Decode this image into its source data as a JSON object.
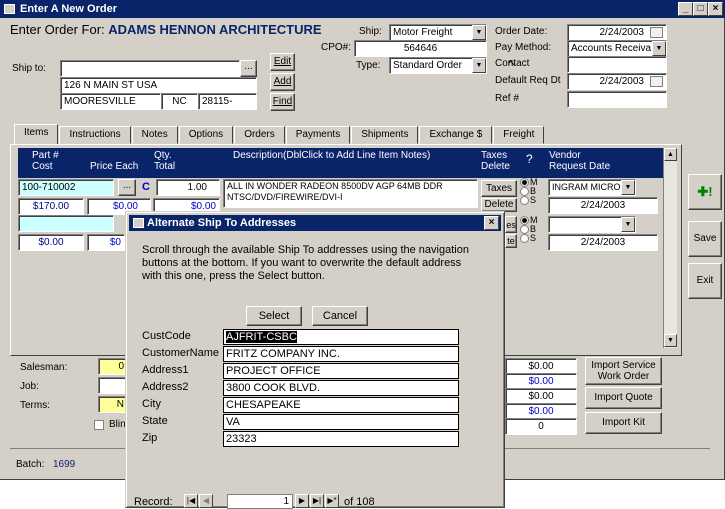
{
  "window": {
    "title": "Enter A New Order",
    "controls": [
      "_",
      "□",
      "×"
    ]
  },
  "header": {
    "enter_order_for_label": "Enter Order For:",
    "customer_name": "ADAMS HENNON ARCHITECTURE",
    "ship_label": "Ship:",
    "ship_value": "Motor Freight",
    "cpo_label": "CPO#:",
    "cpo_value": "564646",
    "type_label": "Type:",
    "type_value": "Standard Order",
    "order_date_label": "Order Date:",
    "order_date_value": "2/24/2003",
    "pay_method_label": "Pay Method:",
    "pay_method_value": "Accounts Receiva",
    "contact_label": "Contact",
    "contact_value": "",
    "default_req_dt_label": "Default Req Dt",
    "default_req_dt_value": "2/24/2003",
    "ref_label": "Ref #",
    "ref_value": "",
    "ship_to_label": "Ship to:",
    "ship_to_line1": "",
    "ship_to_line2": "126 N MAIN ST   USA",
    "ship_to_city": "MOORESVILLE",
    "ship_to_state": "NC",
    "ship_to_zip": "28115-",
    "ellipsis_label": "...",
    "edit_label": "Edit",
    "add_label": "Add",
    "find_label": "Find"
  },
  "tabs": [
    "Items",
    "Instructions",
    "Notes",
    "Options",
    "Orders",
    "Payments",
    "Shipments",
    "Exchange $",
    "Freight"
  ],
  "grid": {
    "headers": {
      "part": "Part #",
      "cost": "Cost",
      "price_each": "Price Each",
      "qty": "Qty.",
      "total": "Total",
      "description": "Description(DblClick to Add Line Item Notes)",
      "taxes": "Taxes",
      "delete": "Delete",
      "question": "?",
      "vendor": "Vendor",
      "request_date": "Request Date"
    },
    "row1": {
      "part": "100-710002",
      "c": "C",
      "qty": "1.00",
      "description": "ALL IN WONDER RADEON 8500DV AGP 64MB DDR NTSC/DVD/FIREWIRE/DVI-I",
      "cost": "$170.00",
      "price": "$0.00",
      "total": "$0.00",
      "taxes_btn": "Taxes",
      "delete_btn": "Delete",
      "vendor": "INGRAM MICRO",
      "request_date": "2/24/2003"
    },
    "row2": {
      "cost": "$0.00",
      "price": "$0",
      "taxes_btn": "es",
      "delete_btn": "te",
      "vendor": "",
      "request_date": "2/24/2003"
    },
    "radio_labels": [
      "M",
      "B",
      "S"
    ]
  },
  "side_buttons": {
    "new_icon": "green-plus-icon",
    "save": "Save",
    "exit": "Exit"
  },
  "bottom": {
    "salesman_label": "Salesman:",
    "salesman_value": "0",
    "job_label": "Job:",
    "terms_label": "Terms:",
    "terms_value": "N",
    "blind_label": "Blin",
    "totals": [
      "$0.00",
      "$0.00",
      "$0.00",
      "$0.00",
      "0"
    ],
    "import_service_label": "Import Service Work Order",
    "import_quote_label": "Import Quote",
    "import_kit_label": "Import Kit",
    "batch_label": "Batch:",
    "batch_value": "1699"
  },
  "dialog": {
    "title": "Alternate Ship To Addresses",
    "instructions": "Scroll through the available Ship To addresses using the navigation buttons at the bottom. If you want to overwrite the default address with this one, press the Select button.",
    "select_label": "Select",
    "cancel_label": "Cancel",
    "fields": [
      {
        "label": "CustCode",
        "value": "AJFRIT-CSBC"
      },
      {
        "label": "CustomerName",
        "value": "FRITZ COMPANY INC."
      },
      {
        "label": "Address1",
        "value": "PROJECT OFFICE"
      },
      {
        "label": "Address2",
        "value": "3800 COOK BLVD."
      },
      {
        "label": "City",
        "value": "CHESAPEAKE"
      },
      {
        "label": "State",
        "value": "VA"
      },
      {
        "label": "Zip",
        "value": "23323"
      }
    ],
    "record_label": "Record:",
    "record_value": "1",
    "record_of": "of 108"
  }
}
